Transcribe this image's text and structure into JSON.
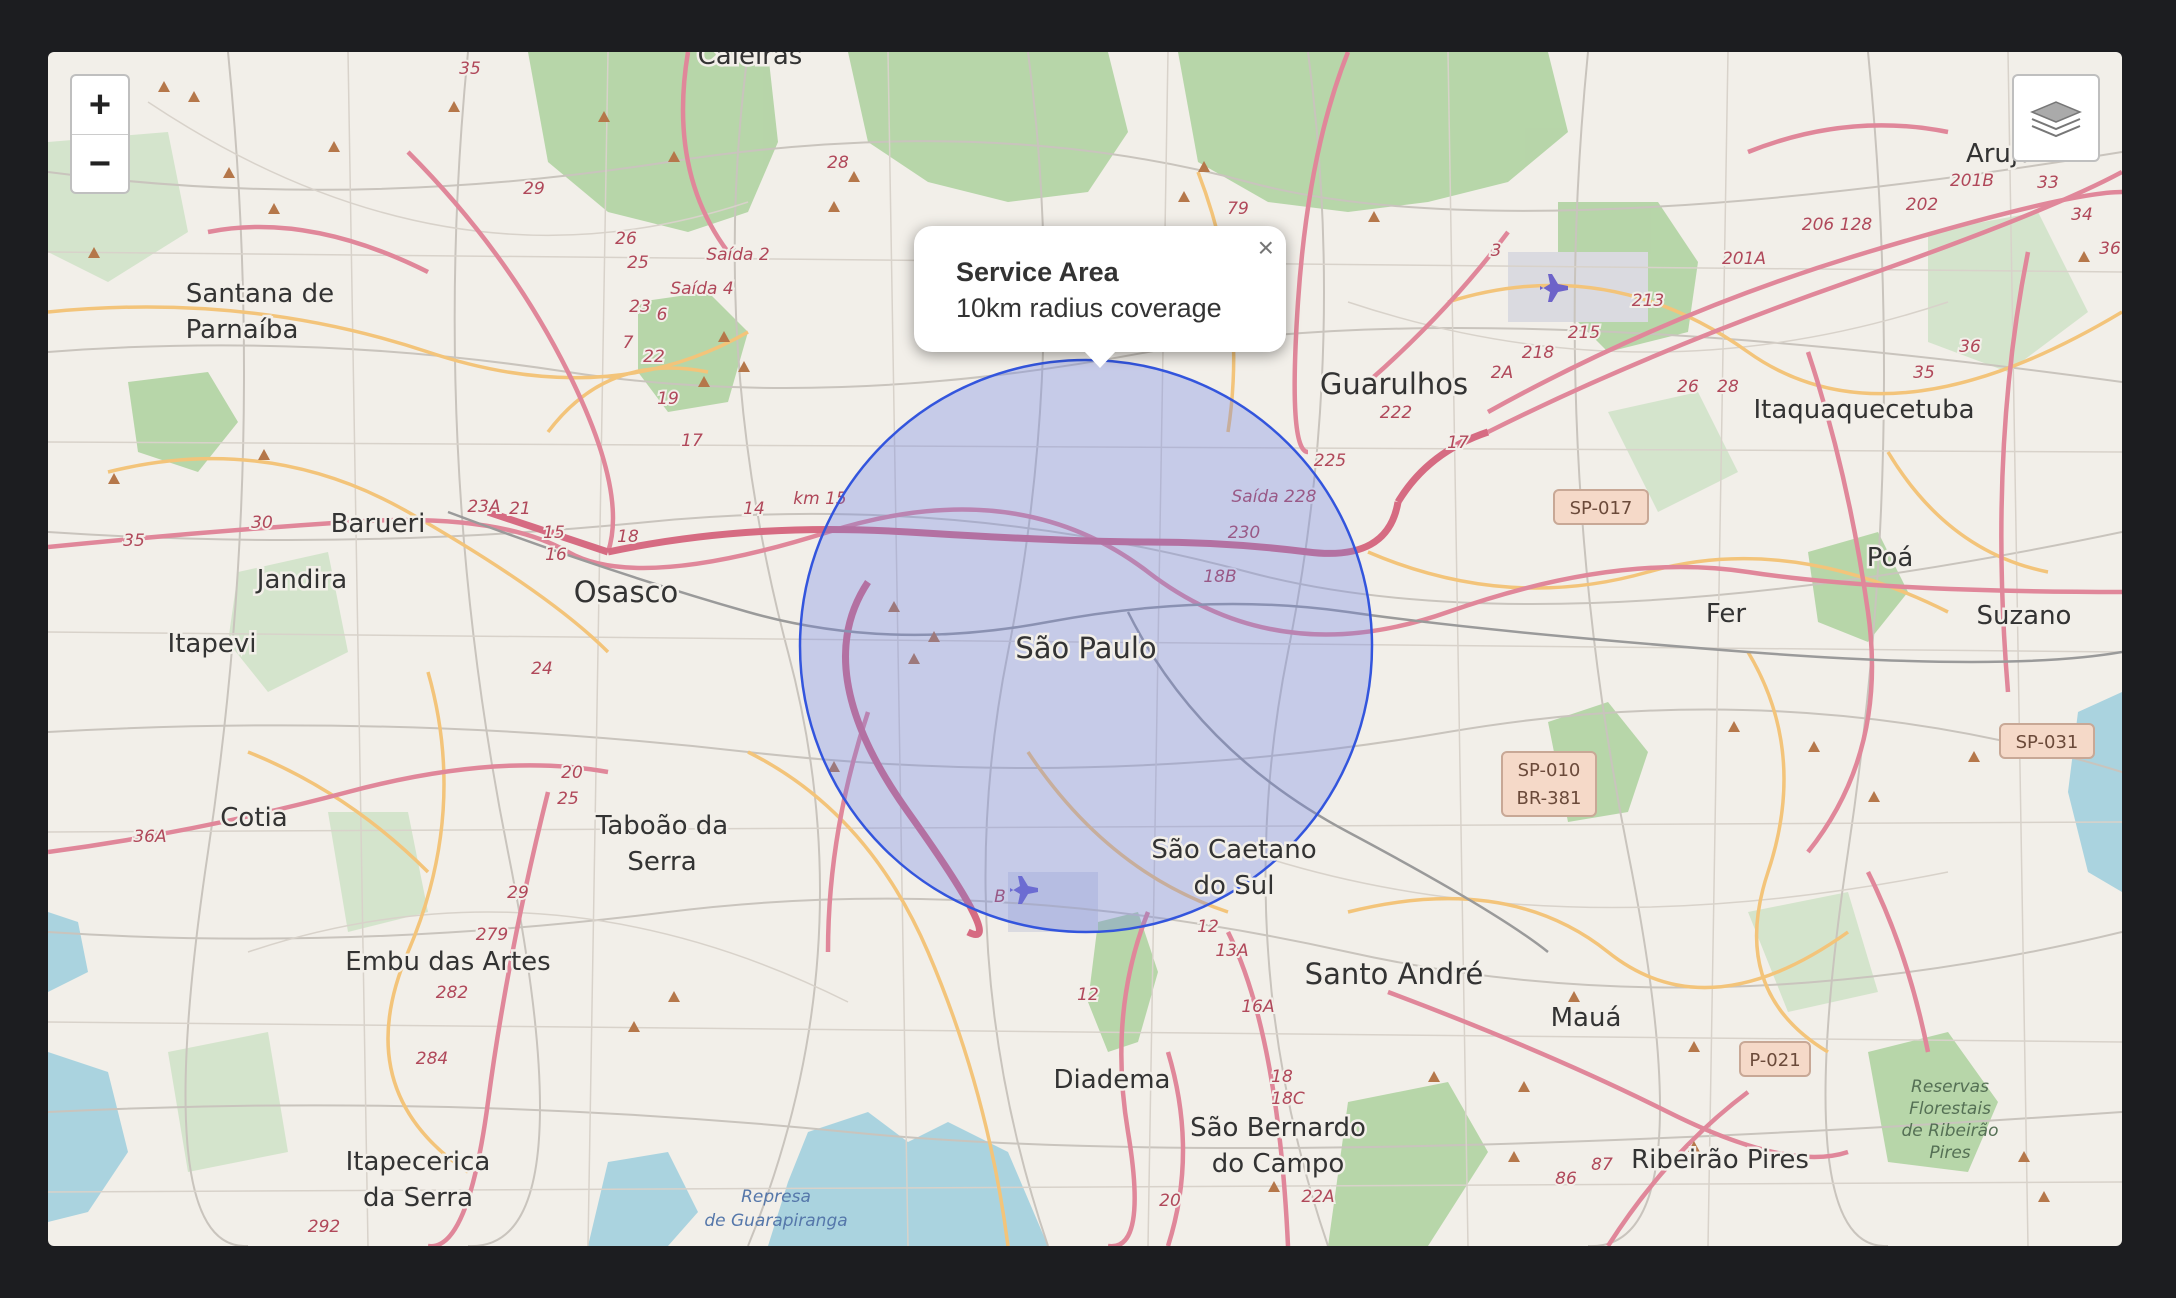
{
  "zoom": {
    "in_label": "+",
    "out_label": "−"
  },
  "popup": {
    "title": "Service Area",
    "description": "10km radius coverage",
    "close_label": "×"
  },
  "cities": [
    "São Paulo",
    "Guarulhos",
    "Itaquaquecetuba",
    "Santana de",
    "Parnaíba",
    "Barueri",
    "Jandira",
    "Osasco",
    "Itapevi",
    "Cotia",
    "Taboão da",
    "Serra",
    "Embu das Artes",
    "Itapecerica",
    "da Serra",
    "São Caetano",
    "do Sul",
    "Santo André",
    "Mauá",
    "Diadema",
    "São Bernardo",
    "do Campo",
    "Ribeirão Pires",
    "Poá",
    "Suzano",
    "Fer",
    "Caieiras",
    "Arujá"
  ],
  "shields": [
    "SP-017",
    "SP-010",
    "BR-381",
    "SP-031",
    "P-021"
  ],
  "route_numbers": [
    "35",
    "29",
    "26",
    "25",
    "23",
    "22",
    "19",
    "17",
    "28",
    "79",
    "23A",
    "21",
    "15",
    "16",
    "30",
    "35",
    "18",
    "14",
    "km 15",
    "Saída 2",
    "Saída 4",
    "Saída 228",
    "230",
    "18B",
    "225",
    "222",
    "218",
    "215",
    "213",
    "201A",
    "206",
    "128",
    "202",
    "201B",
    "34",
    "36",
    "33",
    "26",
    "28",
    "35",
    "17",
    "2A",
    "3",
    "36",
    "36A",
    "20",
    "25",
    "29",
    "279",
    "282",
    "284",
    "292",
    "24",
    "12",
    "13A",
    "16A",
    "18",
    "18C",
    "20",
    "22A",
    "86",
    "87",
    "12",
    "7",
    "6",
    "B"
  ],
  "parks": [
    "Reservas",
    "Florestais",
    "de Ribeirão",
    "Pires"
  ],
  "water": [
    "Represa",
    "de Guarapiranga"
  ],
  "overlay": {
    "type": "circle",
    "radius_km": 10,
    "stroke": "#3355dd",
    "fill": "#6a7fe6"
  },
  "icons": [
    "airport-icon",
    "layers-icon",
    "peak-icon"
  ]
}
